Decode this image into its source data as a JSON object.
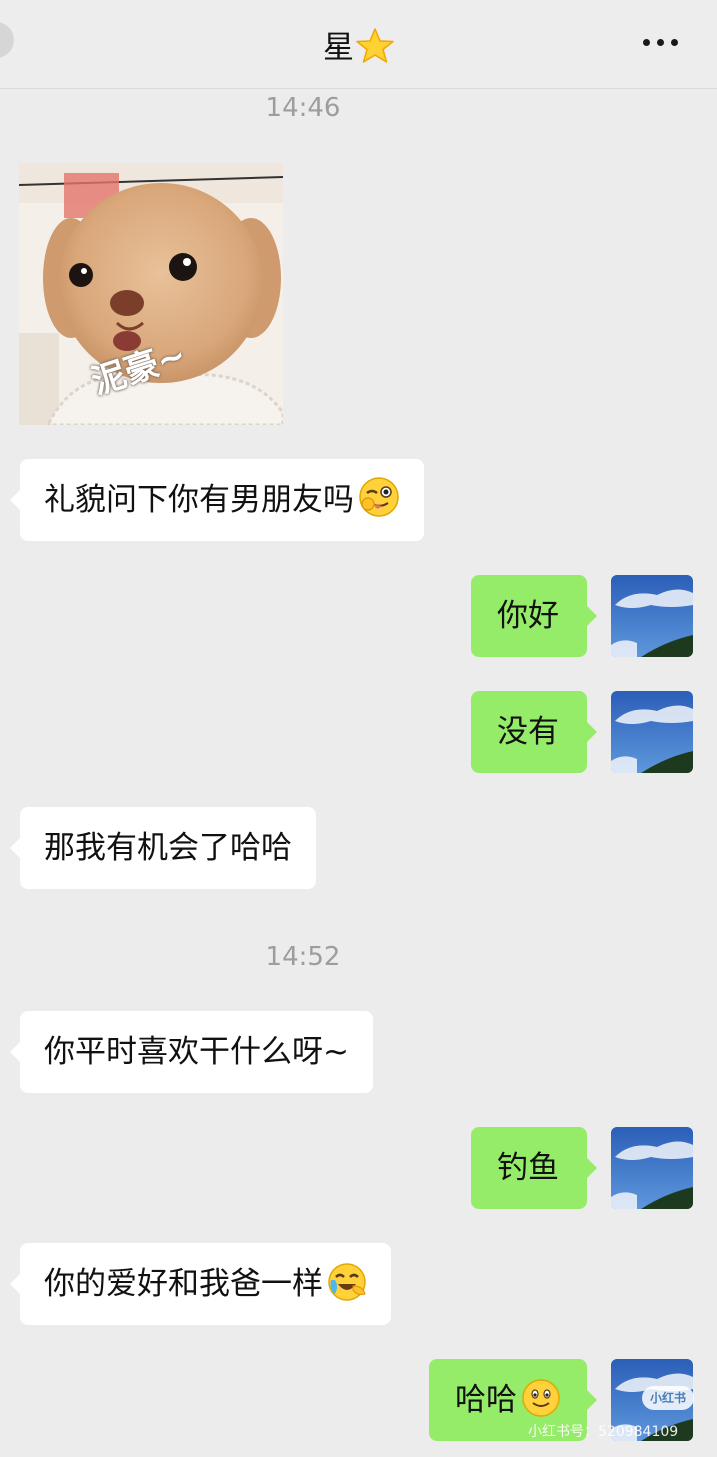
{
  "header": {
    "title": "星",
    "title_emoji": "star-icon",
    "more_icon": "more-icon"
  },
  "timestamps": [
    "14:46",
    "14:52"
  ],
  "sticker": {
    "caption": "泥豪~",
    "image": "plush-puppy-sticker"
  },
  "messages": [
    {
      "side": "left",
      "text": "礼貌问下你有男朋友吗",
      "emoji": "wink-tongue-emoji"
    },
    {
      "side": "right",
      "text": "你好"
    },
    {
      "side": "right",
      "text": "没有"
    },
    {
      "side": "left",
      "text": "那我有机会了哈哈"
    },
    {
      "side": "left",
      "text": "你平时喜欢干什么呀~"
    },
    {
      "side": "right",
      "text": "钓鱼"
    },
    {
      "side": "left",
      "text": "你的爱好和我爸一样",
      "emoji": "laughing-crying-emoji"
    },
    {
      "side": "right",
      "text": "哈哈",
      "emoji": "smile-emoji"
    }
  ],
  "avatar": {
    "image": "blue-sky-avatar"
  },
  "watermark": {
    "badge": "小红书",
    "text": "小红书号：520984109"
  },
  "colors": {
    "background": "#ececec",
    "sent_bubble": "#95ec69",
    "received_bubble": "#ffffff",
    "timestamp": "#9d9d9d"
  }
}
